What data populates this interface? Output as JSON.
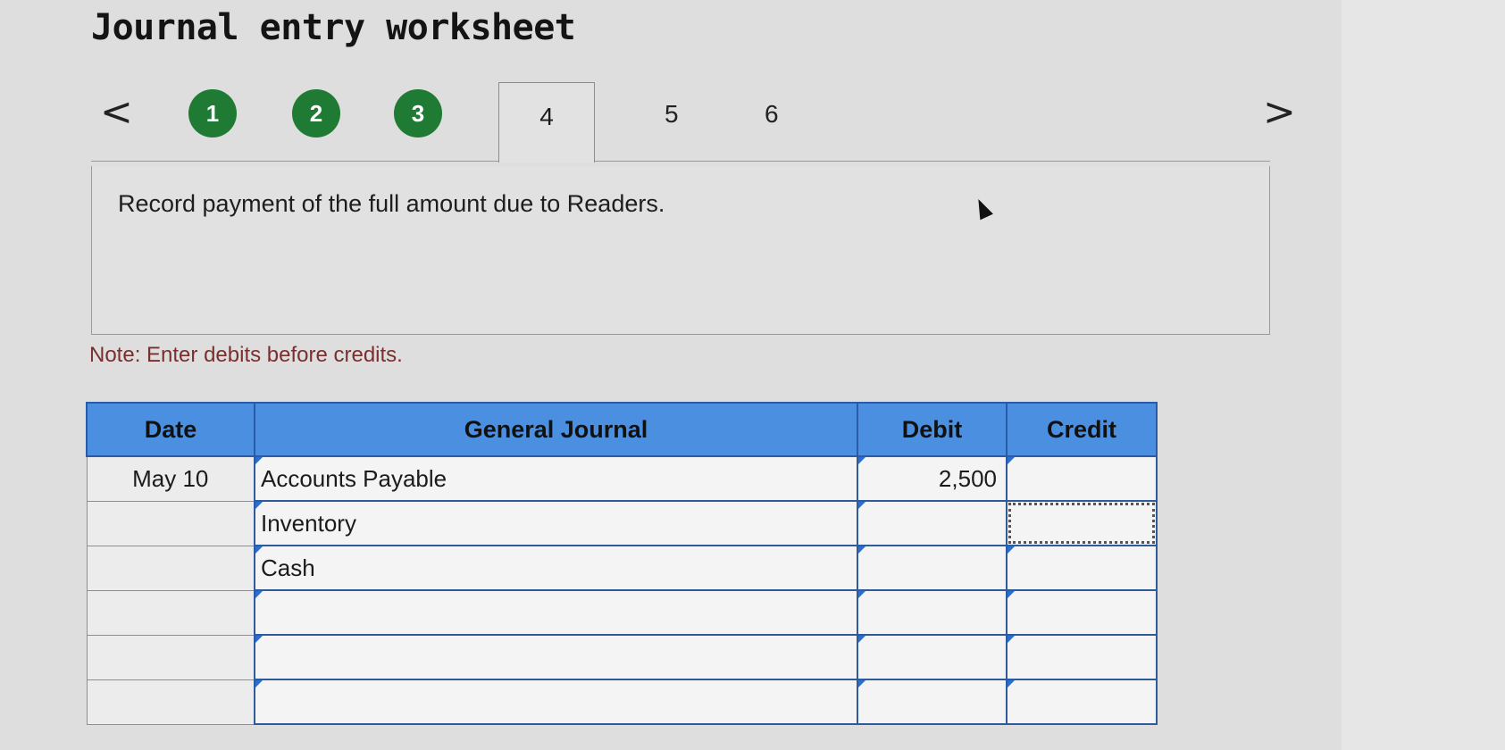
{
  "page": {
    "title": "Journal entry worksheet",
    "prev_arrow": "<",
    "next_arrow": ">"
  },
  "steps": [
    {
      "label": "1",
      "state": "completed"
    },
    {
      "label": "2",
      "state": "completed"
    },
    {
      "label": "3",
      "state": "completed"
    },
    {
      "label": "4",
      "state": "active"
    },
    {
      "label": "5",
      "state": "pending"
    },
    {
      "label": "6",
      "state": "pending"
    }
  ],
  "instruction": "Record payment of the full amount due to Readers.",
  "note": "Note: Enter debits before credits.",
  "table": {
    "headers": {
      "date": "Date",
      "journal": "General Journal",
      "debit": "Debit",
      "credit": "Credit"
    },
    "rows": [
      {
        "date": "May 10",
        "account": "Accounts Payable",
        "debit": "2,500",
        "credit": ""
      },
      {
        "date": "",
        "account": "Inventory",
        "debit": "",
        "credit": ""
      },
      {
        "date": "",
        "account": "Cash",
        "debit": "",
        "credit": ""
      },
      {
        "date": "",
        "account": "",
        "debit": "",
        "credit": ""
      },
      {
        "date": "",
        "account": "",
        "debit": "",
        "credit": ""
      },
      {
        "date": "",
        "account": "",
        "debit": "",
        "credit": ""
      }
    ]
  },
  "colors": {
    "completed_step": "#1f7a34",
    "table_header": "#4a8fe0",
    "cell_border": "#2f5b9a"
  }
}
